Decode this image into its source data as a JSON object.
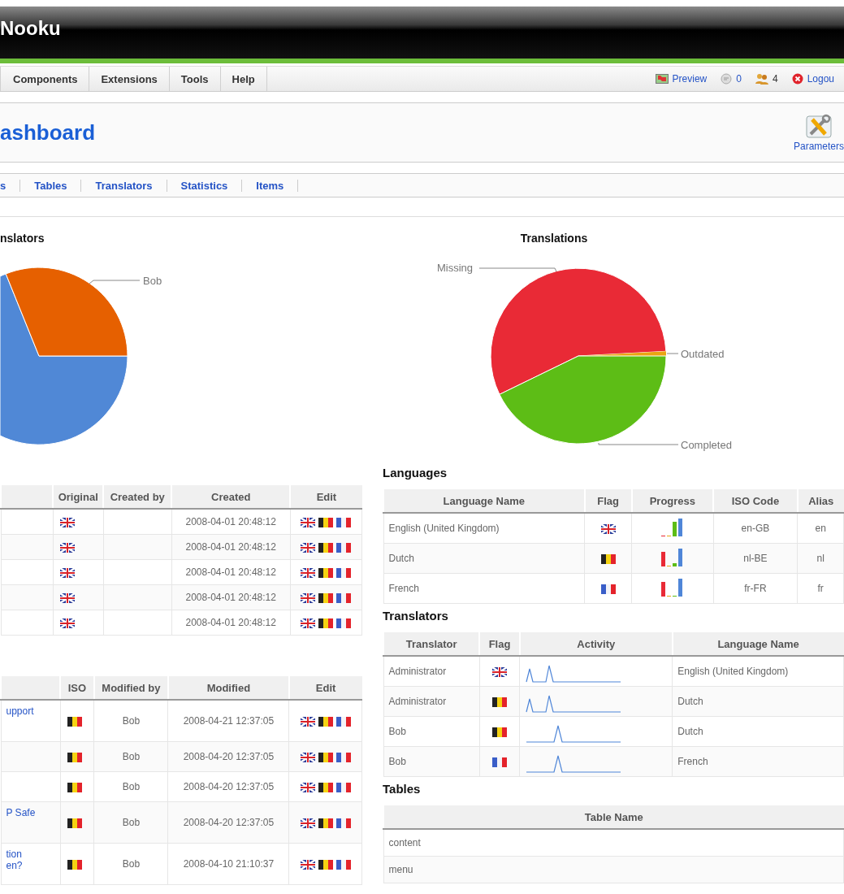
{
  "header": {
    "logo": "Nooku"
  },
  "menu": {
    "items": [
      "Components",
      "Extensions",
      "Tools",
      "Help"
    ],
    "status": [
      {
        "kind": "preview",
        "label": "Preview"
      },
      {
        "kind": "messages",
        "label": "0"
      },
      {
        "kind": "users",
        "label": "4"
      },
      {
        "kind": "logout",
        "label": "Logou"
      }
    ]
  },
  "toolbar": {
    "title": "ashboard",
    "buttons": [
      "Parameters"
    ]
  },
  "submenu": [
    "s",
    "Tables",
    "Translators",
    "Statistics",
    "Items"
  ],
  "charts": [
    {
      "title": "nslators",
      "slices": [
        {
          "label": "Bob",
          "color": "#e66000"
        },
        {
          "color": "#5088d6"
        }
      ]
    },
    {
      "title": "Translations",
      "slices": [
        {
          "label": "Missing",
          "color": "#e92a36"
        },
        {
          "label": "Outdated",
          "color": "#eaa512"
        },
        {
          "label": "Completed",
          "color": "#5dbd16"
        }
      ]
    }
  ],
  "items_table": {
    "columns": [
      "Original",
      "Created by",
      "Created",
      "Edit"
    ],
    "rows": [
      {
        "original": {
          "kind": "uk"
        },
        "created": "2008-04-01 20:48:12",
        "edit": [
          {
            "kind": "uk"
          },
          {
            "kind": "be"
          },
          {
            "kind": "fr"
          }
        ]
      },
      {
        "original": {
          "kind": "uk"
        },
        "created": "2008-04-01 20:48:12",
        "edit": [
          {
            "kind": "uk"
          },
          {
            "kind": "be"
          },
          {
            "kind": "fr"
          }
        ]
      },
      {
        "original": {
          "kind": "uk"
        },
        "created": "2008-04-01 20:48:12",
        "edit": [
          {
            "kind": "uk"
          },
          {
            "kind": "be"
          },
          {
            "kind": "fr"
          }
        ]
      },
      {
        "original": {
          "kind": "uk"
        },
        "created": "2008-04-01 20:48:12",
        "edit": [
          {
            "kind": "uk"
          },
          {
            "kind": "be"
          },
          {
            "kind": "fr"
          }
        ]
      },
      {
        "original": {
          "kind": "uk"
        },
        "created": "2008-04-01 20:48:12",
        "edit": [
          {
            "kind": "uk"
          },
          {
            "kind": "be"
          },
          {
            "kind": "fr"
          }
        ]
      }
    ]
  },
  "translations_table": {
    "columns": [
      "ISO",
      "Modified by",
      "Modified",
      "Edit"
    ],
    "rows": [
      {
        "title": "upport",
        "iso": {
          "kind": "be"
        },
        "modified_by": "Bob",
        "modified": "2008-04-21 12:37:05",
        "edit": [
          {
            "kind": "uk"
          },
          {
            "kind": "be"
          },
          {
            "kind": "fr"
          }
        ]
      },
      {
        "iso": {
          "kind": "be"
        },
        "modified_by": "Bob",
        "modified": "2008-04-20 12:37:05",
        "edit": [
          {
            "kind": "uk"
          },
          {
            "kind": "be"
          },
          {
            "kind": "fr"
          }
        ]
      },
      {
        "iso": {
          "kind": "be"
        },
        "modified_by": "Bob",
        "modified": "2008-04-20 12:37:05",
        "edit": [
          {
            "kind": "uk"
          },
          {
            "kind": "be"
          },
          {
            "kind": "fr"
          }
        ]
      },
      {
        "title": "P Safe",
        "iso": {
          "kind": "be"
        },
        "modified_by": "Bob",
        "modified": "2008-04-20 12:37:05",
        "edit": [
          {
            "kind": "uk"
          },
          {
            "kind": "be"
          },
          {
            "kind": "fr"
          }
        ]
      },
      {
        "title": "tion\nen?",
        "iso": {
          "kind": "be"
        },
        "modified_by": "Bob",
        "modified": "2008-04-10 21:10:37",
        "edit": [
          {
            "kind": "uk"
          },
          {
            "kind": "be"
          },
          {
            "kind": "fr"
          }
        ]
      }
    ]
  },
  "languages": {
    "heading": "Languages",
    "columns": [
      "Language Name",
      "Flag",
      "Progress",
      "ISO Code",
      "Alias"
    ],
    "rows": [
      {
        "name": "English (United Kingdom)",
        "flag": {
          "kind": "uk"
        },
        "iso": "en-GB",
        "alias": "en"
      },
      {
        "name": "Dutch",
        "flag": {
          "kind": "be"
        },
        "iso": "nl-BE",
        "alias": "nl"
      },
      {
        "name": "French",
        "flag": {
          "kind": "fr"
        },
        "iso": "fr-FR",
        "alias": "fr"
      }
    ]
  },
  "translators": {
    "heading": "Translators",
    "columns": [
      "Translator",
      "Flag",
      "Activity",
      "Language Name"
    ],
    "rows": [
      {
        "translator": "Administrator",
        "flag": {
          "kind": "uk"
        },
        "language": "English (United Kingdom)"
      },
      {
        "translator": "Administrator",
        "flag": {
          "kind": "be"
        },
        "language": "Dutch"
      },
      {
        "translator": "Bob",
        "flag": {
          "kind": "be"
        },
        "language": "Dutch"
      },
      {
        "translator": "Bob",
        "flag": {
          "kind": "fr"
        },
        "language": "French"
      }
    ]
  },
  "tables": {
    "heading": "Tables",
    "columns": [
      "Table Name"
    ],
    "rows": [
      "content",
      "menu"
    ]
  }
}
